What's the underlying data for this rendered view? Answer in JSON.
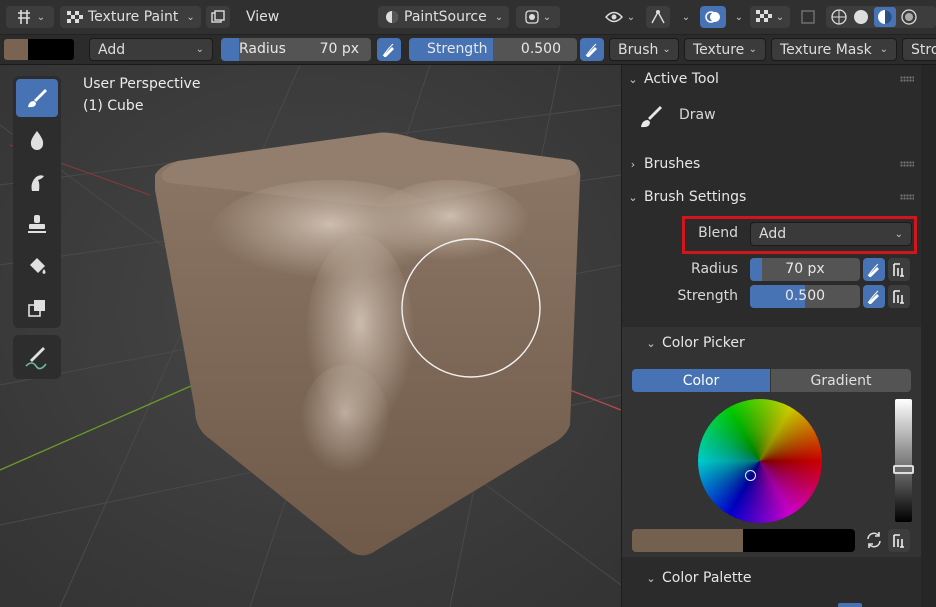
{
  "header": {
    "mode": "Texture Paint",
    "view_menu": "View",
    "paint_source": "PaintSource"
  },
  "tool_settings": {
    "primary_color": "#7a6350",
    "secondary_color": "#000000",
    "blend": "Add",
    "radius_label": "Radius",
    "radius_value": "70 px",
    "strength_label": "Strength",
    "strength_value": "0.500",
    "strength_fraction": 0.5,
    "menus": [
      "Brush",
      "Texture",
      "Texture Mask",
      "Stroke"
    ]
  },
  "viewport": {
    "view_name": "User Perspective",
    "object_name": "(1) Cube"
  },
  "toolbar": {
    "tools": [
      "draw-tool",
      "soften-tool",
      "smear-tool",
      "clone-tool",
      "fill-tool",
      "mask-tool",
      "annotate-tool"
    ]
  },
  "panel": {
    "active_tool": {
      "title": "Active Tool",
      "tool_name": "Draw"
    },
    "brushes": {
      "title": "Brushes"
    },
    "brush_settings": {
      "title": "Brush Settings",
      "blend_label": "Blend",
      "blend_value": "Add",
      "radius_label": "Radius",
      "radius_value": "70 px",
      "strength_label": "Strength",
      "strength_value": "0.500"
    },
    "color_picker": {
      "title": "Color Picker",
      "tab_color": "Color",
      "tab_gradient": "Gradient",
      "primary_color": "#74604e",
      "secondary_color": "#000000"
    },
    "color_palette": {
      "title": "Color Palette"
    }
  },
  "colors": {
    "accent": "#4772b3",
    "highlight_box": "#d0161c"
  }
}
